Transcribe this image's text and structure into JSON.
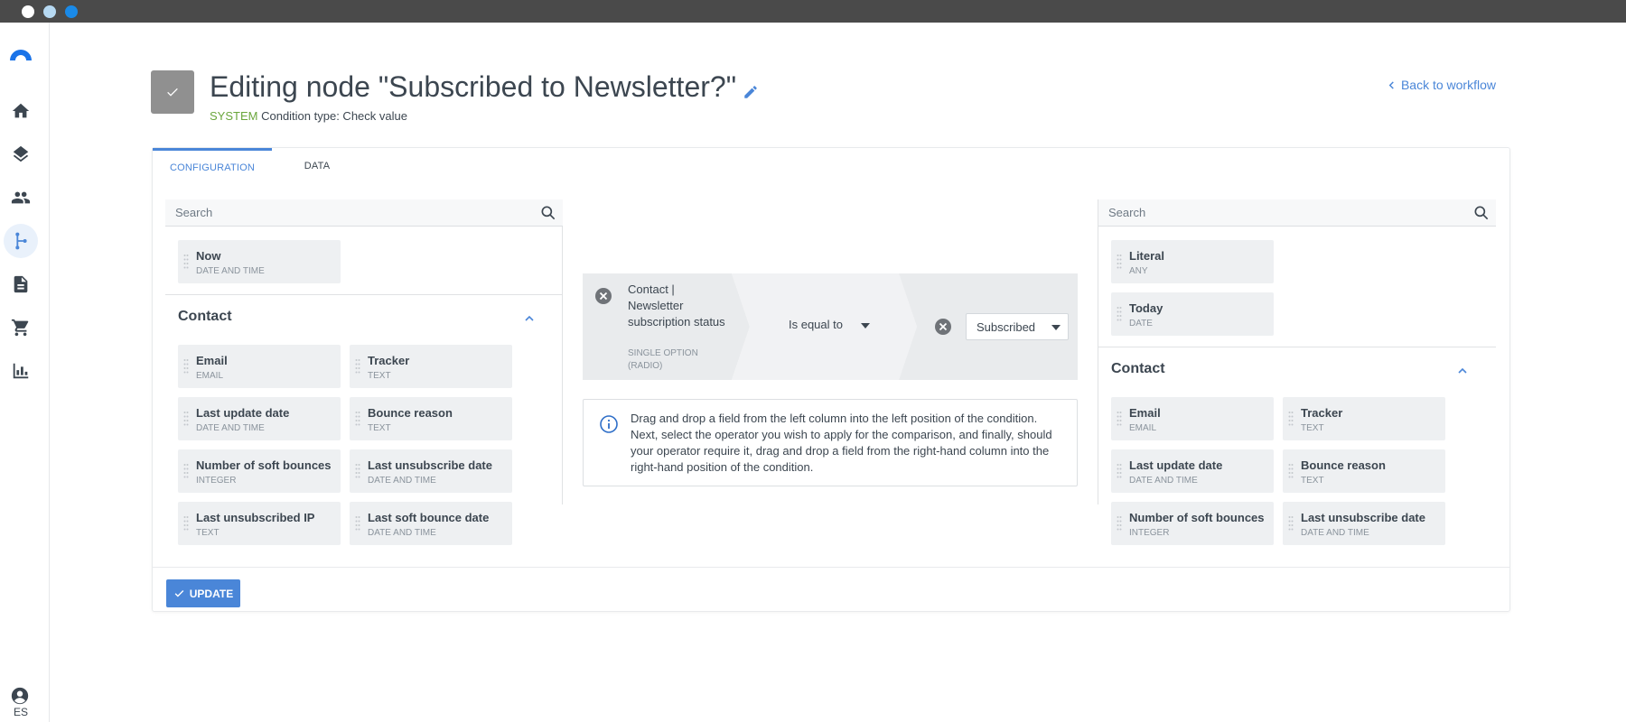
{
  "window": {
    "controls": [
      "close",
      "minimize",
      "maximize"
    ]
  },
  "sidebar": {
    "logo_icon": "brand-arc-icon",
    "items": [
      {
        "icon": "home-icon",
        "active": false
      },
      {
        "icon": "layers-icon",
        "active": false
      },
      {
        "icon": "contacts-icon",
        "active": false
      },
      {
        "icon": "workflow-icon",
        "active": true
      },
      {
        "icon": "document-icon",
        "active": false
      },
      {
        "icon": "cart-icon",
        "active": false
      },
      {
        "icon": "bar-chart-icon",
        "active": false
      }
    ],
    "user": {
      "icon": "account-icon",
      "language": "ES"
    }
  },
  "header": {
    "node_icon": "check-icon",
    "title": "Editing node \"Subscribed to Newsletter?\"",
    "subtitle_badge": "SYSTEM",
    "subtitle_text": "Condition type: Check value",
    "back_link": "Back to workflow"
  },
  "tabs": [
    {
      "label": "CONFIGURATION",
      "active": true
    },
    {
      "label": "DATA",
      "active": false
    }
  ],
  "left_column": {
    "search_placeholder": "Search",
    "top_fields": [
      {
        "name": "Now",
        "type": "DATE AND TIME"
      }
    ],
    "group": {
      "title": "Contact",
      "fields": [
        {
          "name": "Email",
          "type": "EMAIL"
        },
        {
          "name": "Tracker",
          "type": "TEXT"
        },
        {
          "name": "Last update date",
          "type": "DATE AND TIME"
        },
        {
          "name": "Bounce reason",
          "type": "TEXT"
        },
        {
          "name": "Number of soft bounces",
          "type": "INTEGER"
        },
        {
          "name": "Last unsubscribe date",
          "type": "DATE AND TIME"
        },
        {
          "name": "Last unsubscribed IP",
          "type": "TEXT"
        },
        {
          "name": "Last soft bounce date",
          "type": "DATE AND TIME"
        }
      ]
    }
  },
  "condition": {
    "left_field": "Contact | Newsletter subscription status",
    "left_field_type": "SINGLE OPTION (RADIO)",
    "operator": "Is equal to",
    "right_value": "Subscribed"
  },
  "info": {
    "text": "Drag and drop a field from the left column into the left position of the condition. Next, select the operator you wish to apply for the comparison, and finally, should your operator require it, drag and drop a field from the right-hand column into the right-hand position of the condition."
  },
  "right_column": {
    "search_placeholder": "Search",
    "top_fields": [
      {
        "name": "Literal",
        "type": "ANY"
      },
      {
        "name": "Today",
        "type": "DATE"
      }
    ],
    "group": {
      "title": "Contact",
      "fields": [
        {
          "name": "Email",
          "type": "EMAIL"
        },
        {
          "name": "Tracker",
          "type": "TEXT"
        },
        {
          "name": "Last update date",
          "type": "DATE AND TIME"
        },
        {
          "name": "Bounce reason",
          "type": "TEXT"
        },
        {
          "name": "Number of soft bounces",
          "type": "INTEGER"
        },
        {
          "name": "Last unsubscribe date",
          "type": "DATE AND TIME"
        }
      ]
    }
  },
  "footer": {
    "update_label": "UPDATE"
  },
  "colors": {
    "accent": "#4a86d8",
    "system_badge": "#6aa63c",
    "field_bg": "#eef0f2",
    "condition_bg": "#eceef0"
  }
}
